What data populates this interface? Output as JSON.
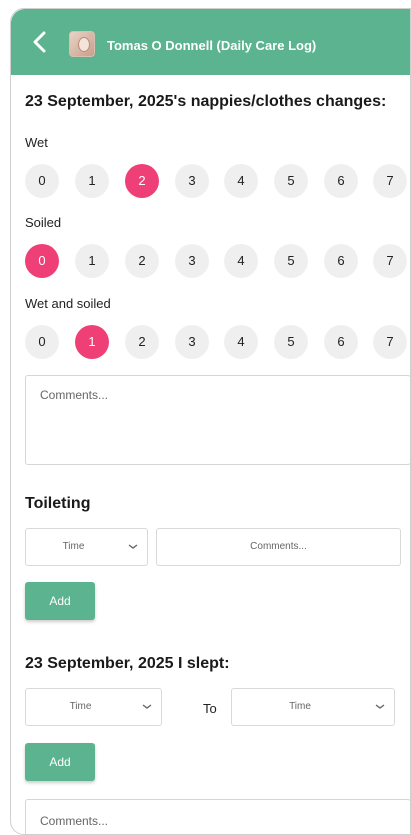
{
  "header": {
    "title": "Tomas O Donnell (Daily Care Log)"
  },
  "nappies": {
    "heading": "23 September, 2025's nappies/clothes changes:",
    "options": [
      "0",
      "1",
      "2",
      "3",
      "4",
      "5",
      "6",
      "7"
    ],
    "wet": {
      "label": "Wet",
      "selected": 2
    },
    "soiled": {
      "label": "Soiled",
      "selected": 0
    },
    "wet_and_soiled": {
      "label": "Wet and soiled",
      "selected": 1
    },
    "comments_placeholder": "Comments..."
  },
  "toileting": {
    "heading": "Toileting",
    "time_placeholder": "Time",
    "comments_placeholder": "Comments...",
    "add_label": "Add"
  },
  "sleep": {
    "heading": "23 September, 2025 I slept:",
    "from_placeholder": "Time",
    "to_label": "To",
    "to_placeholder": "Time",
    "add_label": "Add",
    "comments_placeholder": "Comments..."
  },
  "colors": {
    "accent": "#5bb38f",
    "selected": "#ee3f76"
  }
}
